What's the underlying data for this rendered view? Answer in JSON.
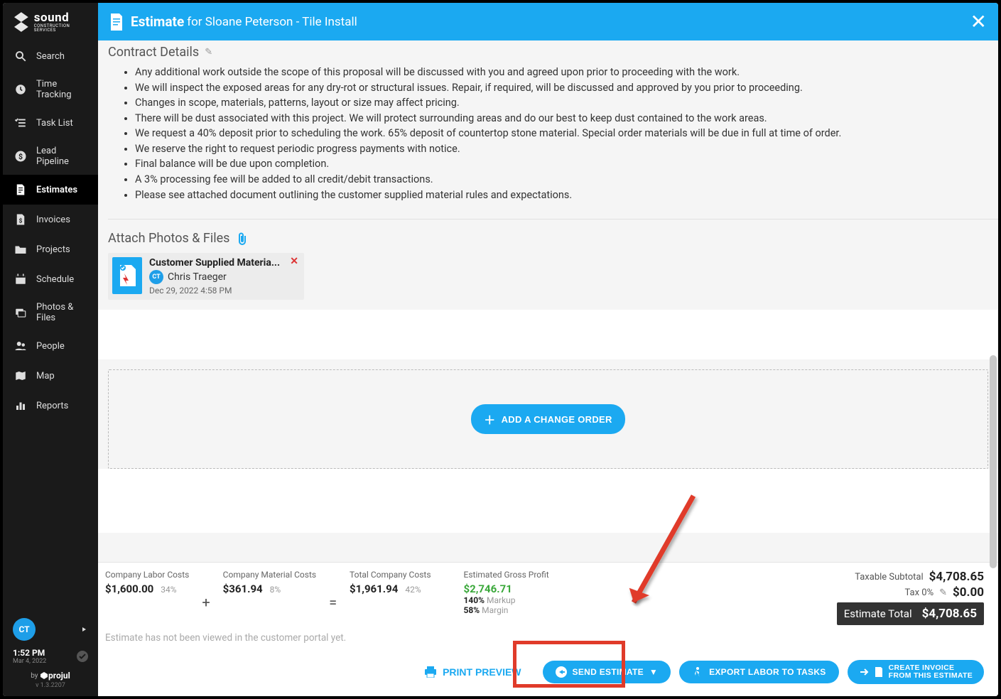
{
  "brand": {
    "name": "sound",
    "sub": "CONSTRUCTION SERVICES"
  },
  "nav": [
    {
      "label": "Search",
      "icon": "search-icon"
    },
    {
      "label": "Time Tracking",
      "icon": "clock-icon"
    },
    {
      "label": "Task List",
      "icon": "tasklist-icon"
    },
    {
      "label": "Lead Pipeline",
      "icon": "dollar-circle-icon"
    },
    {
      "label": "Estimates",
      "icon": "document-icon",
      "active": true
    },
    {
      "label": "Invoices",
      "icon": "invoice-icon"
    },
    {
      "label": "Projects",
      "icon": "folder-icon"
    },
    {
      "label": "Schedule",
      "icon": "calendar-icon"
    },
    {
      "label": "Photos & Files",
      "icon": "photos-icon"
    },
    {
      "label": "People",
      "icon": "people-icon"
    },
    {
      "label": "Map",
      "icon": "map-icon"
    },
    {
      "label": "Reports",
      "icon": "reports-icon"
    }
  ],
  "user": {
    "initials": "CT"
  },
  "footer": {
    "time": "1:52 PM",
    "date": "Mar 4, 2022",
    "by": "by",
    "projul": "projul",
    "version": "v 1.3.2207"
  },
  "topbar": {
    "title": "Estimate",
    "sub": "for Sloane Peterson - Tile Install"
  },
  "section": {
    "contract_title": "Contract Details",
    "bullets": [
      "Any additional work outside the scope of this proposal will be discussed with you and agreed upon prior to proceeding with the work.",
      "We will inspect the exposed areas for any dry-rot or structural issues. Repair, if required, will be discussed and approved by you prior to proceeding.",
      "Changes in scope, materials, patterns, layout or size may affect pricing.",
      "There will be dust associated with this project. We will protect surrounding areas and do our best to keep dust contained to the work areas.",
      "We request a 40% deposit prior to scheduling the work. 65% deposit of countertop stone material. Special order materials will be due in full at time of order.",
      "We reserve the right to request periodic progress payments with notice.",
      "Final balance will be due upon completion.",
      "A 3% processing fee will be added to all credit/debit transactions.",
      "Please see attached document outlining the customer supplied material rules and expectations."
    ],
    "attach_title": "Attach Photos & Files"
  },
  "attachment": {
    "name": "Customer Supplied Materia...",
    "user_initials": "CT",
    "user_name": "Chris Traeger",
    "date": "Dec 29, 2022 4:58 PM"
  },
  "change_order_btn": "ADD A CHANGE ORDER",
  "totals": {
    "labor": {
      "label": "Company Labor Costs",
      "value": "$1,600.00",
      "pct": "34%"
    },
    "material": {
      "label": "Company Material Costs",
      "value": "$361.94",
      "pct": "8%"
    },
    "total": {
      "label": "Total Company Costs",
      "value": "$1,961.94",
      "pct": "42%"
    },
    "profit": {
      "label": "Estimated Gross Profit",
      "value": "$2,746.71",
      "markup_pct": "140%",
      "markup_label": "Markup",
      "margin_pct": "58%",
      "margin_label": "Margin"
    },
    "right": {
      "taxable_label": "Taxable Subtotal",
      "taxable_value": "$4,708.65",
      "tax_label": "Tax 0%",
      "tax_value": "$0.00",
      "total_label": "Estimate Total",
      "total_value": "$4,708.65"
    }
  },
  "viewed_note": "Estimate has not been viewed in the customer portal yet.",
  "actions": {
    "print": "PRINT PREVIEW",
    "send": "SEND ESTIMATE",
    "export": "EXPORT LABOR TO TASKS",
    "create_line1": "CREATE INVOICE",
    "create_line2": "FROM THIS ESTIMATE"
  }
}
